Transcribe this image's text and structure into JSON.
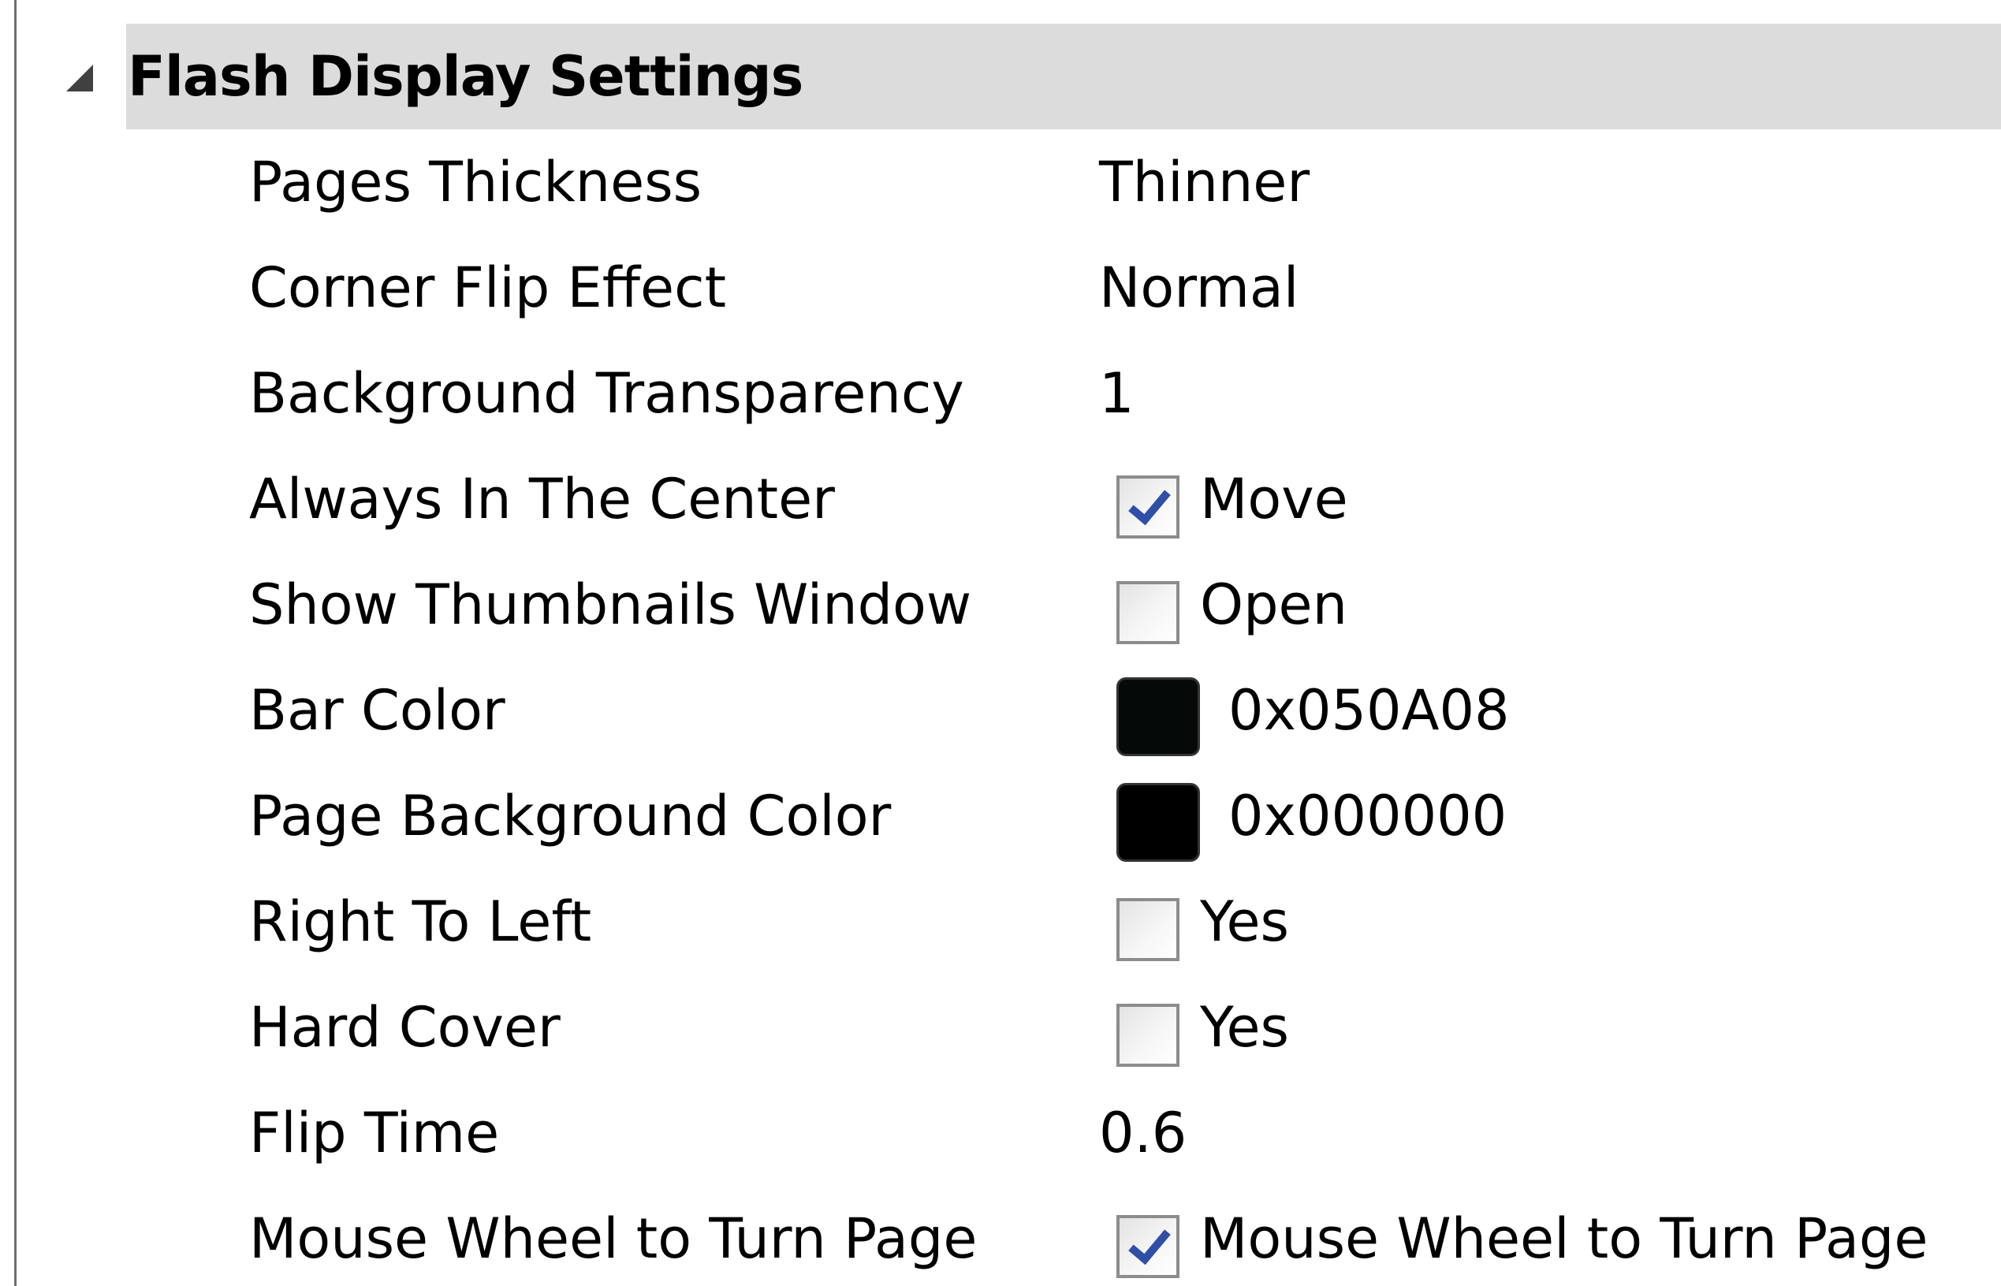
{
  "group": {
    "title": "Flash Display Settings"
  },
  "properties": [
    {
      "label": "Pages Thickness",
      "value": "Thinner"
    },
    {
      "label": "Corner Flip Effect",
      "value": "Normal"
    },
    {
      "label": "Background Transparency",
      "value": "1"
    },
    {
      "label": "Always In The Center",
      "checked": true,
      "value": "Move"
    },
    {
      "label": "Show Thumbnails Window",
      "checked": false,
      "value": "Open"
    },
    {
      "label": "Bar Color",
      "color": "#050A08",
      "value": "0x050A08"
    },
    {
      "label": "Page Background Color",
      "color": "#000000",
      "value": "0x000000"
    },
    {
      "label": "Right To Left",
      "checked": false,
      "value": "Yes"
    },
    {
      "label": "Hard Cover",
      "checked": false,
      "value": "Yes"
    },
    {
      "label": "Flip Time",
      "value": "0.6"
    },
    {
      "label": "Mouse Wheel to Turn Page",
      "checked": true,
      "value": "Mouse Wheel to Turn Page"
    }
  ],
  "icons": {
    "collapse": "triangle-collapse-icon",
    "checkmark": "checkmark-icon"
  }
}
